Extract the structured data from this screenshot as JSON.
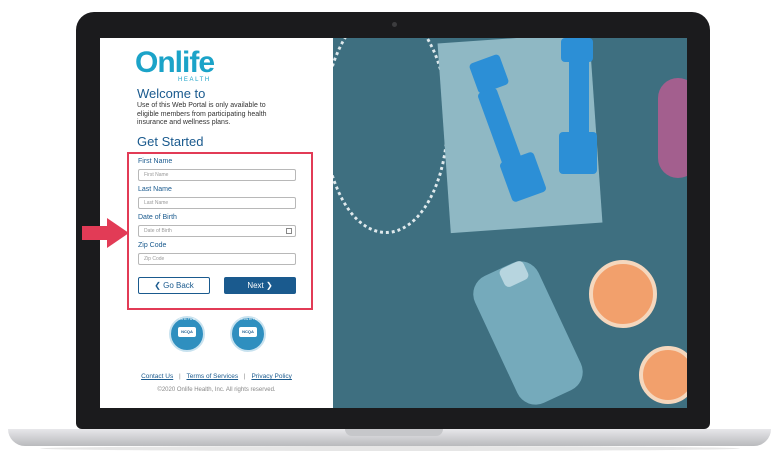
{
  "logo": {
    "name": "Onlife",
    "sub": "HEALTH"
  },
  "welcome_title": "Welcome to",
  "intro_text": "Use of this Web Portal is only available to eligible members from participating health insurance and wellness plans.",
  "get_started": "Get Started",
  "form": {
    "first_name": {
      "label": "First Name",
      "placeholder": "First Name"
    },
    "last_name": {
      "label": "Last Name",
      "placeholder": "Last Name"
    },
    "dob": {
      "label": "Date of Birth",
      "placeholder": "Date of Birth"
    },
    "zip": {
      "label": "Zip Code",
      "placeholder": "Zip Code"
    },
    "back_button": "❮ Go Back",
    "next_button": "Next ❯"
  },
  "badges": {
    "left": {
      "top": "AUDITED",
      "center": "NCQA"
    },
    "right": {
      "top": "ACCREDITED",
      "center": "NCQA"
    }
  },
  "footer": {
    "contact": "Contact Us",
    "terms": "Terms of Services",
    "privacy": "Privacy Policy",
    "copyright": "©2020 Onlife Health, Inc. All rights reserved."
  },
  "colors": {
    "accent": "#1a5a8e",
    "brand": "#1ba3c8",
    "highlight": "#e23b56"
  }
}
